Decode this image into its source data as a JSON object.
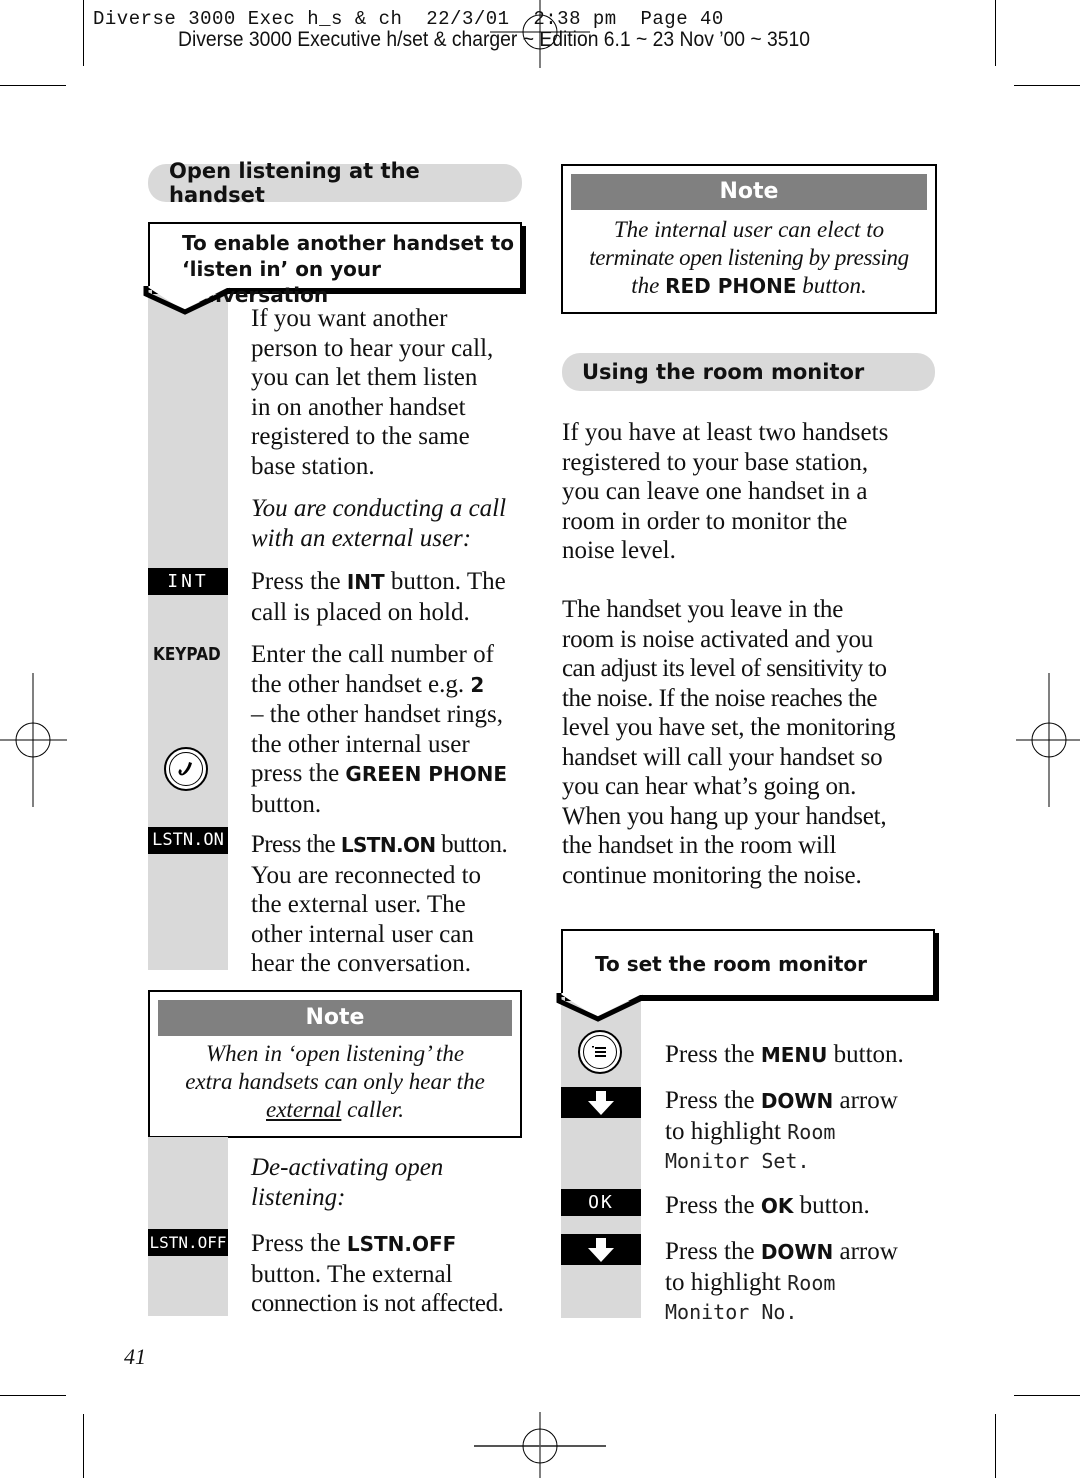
{
  "header": {
    "slug": "Diverse 3000 Exec h_s & ch  22/3/01  2:38 pm  Page 40",
    "edition": "Diverse 3000 Executive h/set & charger ~ Edition 6.1 ~ 23 Nov ’00 ~ 3510"
  },
  "left": {
    "section_title": "Open listening at the handset",
    "task_title_line1": "To enable another handset to",
    "task_title_line2": "‘listen in’ on your conversation",
    "intro": [
      "If you want another",
      "person to hear your call,",
      "you can let them listen",
      "in on another handset",
      "registered to the same",
      "base station."
    ],
    "context_italic": [
      "You are conducting a call",
      "with an external user:"
    ],
    "steps": [
      {
        "key": "INT",
        "key_style": "black-label",
        "text_pre": "Press the ",
        "text_bold": "INT",
        "text_post": " button. The",
        "text_line2": "call is placed on hold."
      },
      {
        "key": "KEYPAD",
        "key_style": "bold-text",
        "lines": [
          "Enter the call number of",
          "the other handset e.g. ",
          "– the other handset rings,",
          "the other internal user",
          "press the ",
          "button."
        ],
        "bold_number": "2",
        "bold_phone": "GREEN PHONE",
        "icon": "green-phone-icon"
      },
      {
        "key": "LSTN.ON",
        "key_style": "black-label",
        "text_pre": "Press the ",
        "text_bold": "LSTN.ON",
        "text_post": " button.",
        "more": [
          "You are reconnected to",
          "the external user. The",
          "other internal user can",
          "hear the conversation."
        ]
      }
    ],
    "note": {
      "heading": "Note",
      "line1": "When in ‘open listening’ the",
      "line2": "extra handsets can only hear the",
      "line3_underlined": "external",
      "line3_rest": " caller."
    },
    "deactivate_italic": [
      "De-activating open",
      "listening:"
    ],
    "deactivate_step": {
      "key": "LSTN.OFF",
      "text_pre": "Press the ",
      "text_bold": "LSTN.OFF",
      "more": [
        "button. The external",
        "connection is not affected."
      ]
    }
  },
  "right": {
    "note": {
      "heading": "Note",
      "line1": "The internal user can elect to",
      "line2": "terminate open listening by pressing",
      "line3_pre": "the ",
      "line3_bold": "RED PHONE",
      "line3_post": " button."
    },
    "section_title": "Using the room monitor",
    "para1": [
      "If you have at least two handsets",
      "registered to your base station,",
      "you can leave one handset in a",
      "room in order to monitor the",
      "noise level."
    ],
    "para2": [
      "The handset you leave in the",
      "room is noise activated and you",
      "can adjust its level of sensitivity to",
      "the noise. If the noise reaches the",
      "level you have set, the monitoring",
      "handset will call your handset so",
      "you can hear what’s going on.",
      "When you hang up your handset,",
      "the handset in the room will",
      "continue monitoring the noise."
    ],
    "task_title": "To set the room monitor",
    "steps": [
      {
        "icon": "menu-button-icon",
        "pre": "Press the ",
        "bold": "MENU",
        "post": " button."
      },
      {
        "icon": "down-arrow-icon",
        "pre": "Press the ",
        "bold": "DOWN",
        "post": " arrow",
        "line2": "to highlight ",
        "lcd1": "Room",
        "lcd2": "Monitor Set."
      },
      {
        "key": "OK",
        "pre": "Press the ",
        "bold": "OK",
        "post": " button."
      },
      {
        "icon": "down-arrow-icon",
        "pre": "Press the ",
        "bold": "DOWN",
        "post": " arrow",
        "line2": "to highlight ",
        "lcd1": "Room",
        "lcd2": "Monitor No."
      }
    ]
  },
  "footer": {
    "page_number": "41"
  }
}
